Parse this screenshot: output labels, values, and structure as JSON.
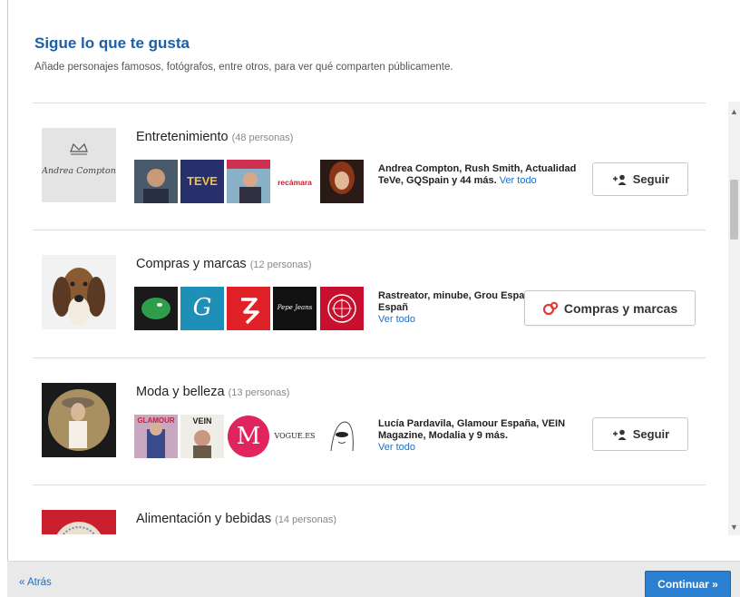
{
  "header": {
    "title": "Sigue lo que te gusta",
    "subtitle": "Añade personajes famosos, fotógrafos, entre otros, para ver qué comparten públicamente."
  },
  "categories": [
    {
      "name": "Entretenimiento",
      "count": "(48 personas)",
      "avatar_text": "Andrea Compton",
      "thumb_texts": [
        "",
        "TEVE",
        "",
        "recámara",
        ""
      ],
      "description": "Andrea Compton, Rush Smith, Actualidad TeVe, GQSpain y 44 más.",
      "link": "Ver todo",
      "button_label": "Seguir",
      "button_icon": "add-person-icon"
    },
    {
      "name": "Compras y marcas",
      "count": "(12 personas)",
      "thumb_texts": [
        "",
        "G",
        "",
        "Pepe Jeans",
        ""
      ],
      "description": "Rastreator, minube, Grou España, Atrápalo Españ",
      "link": "Ver todo",
      "button_label": "Compras y marcas",
      "button_icon": "circles-icon"
    },
    {
      "name": "Moda y belleza",
      "count": "(13 personas)",
      "thumb_texts": [
        "GLAMOUR",
        "VEIN",
        "M",
        "VOGUE.ES",
        ""
      ],
      "description": "Lucía Pardavila, Glamour España, VEIN Magazine, Modalia y 9 más.",
      "link": "Ver todo",
      "button_label": "Seguir",
      "button_icon": "add-person-icon"
    },
    {
      "name": "Alimentación y bebidas",
      "count": "(14 personas)"
    }
  ],
  "footer": {
    "back_label": "« Atrás",
    "continue_label": "Continuar »"
  },
  "colors": {
    "accent": "#1d5fa6",
    "link": "#1d6fc4",
    "continue_button": "#2a7fd0",
    "circles_icon": "#e53935"
  }
}
